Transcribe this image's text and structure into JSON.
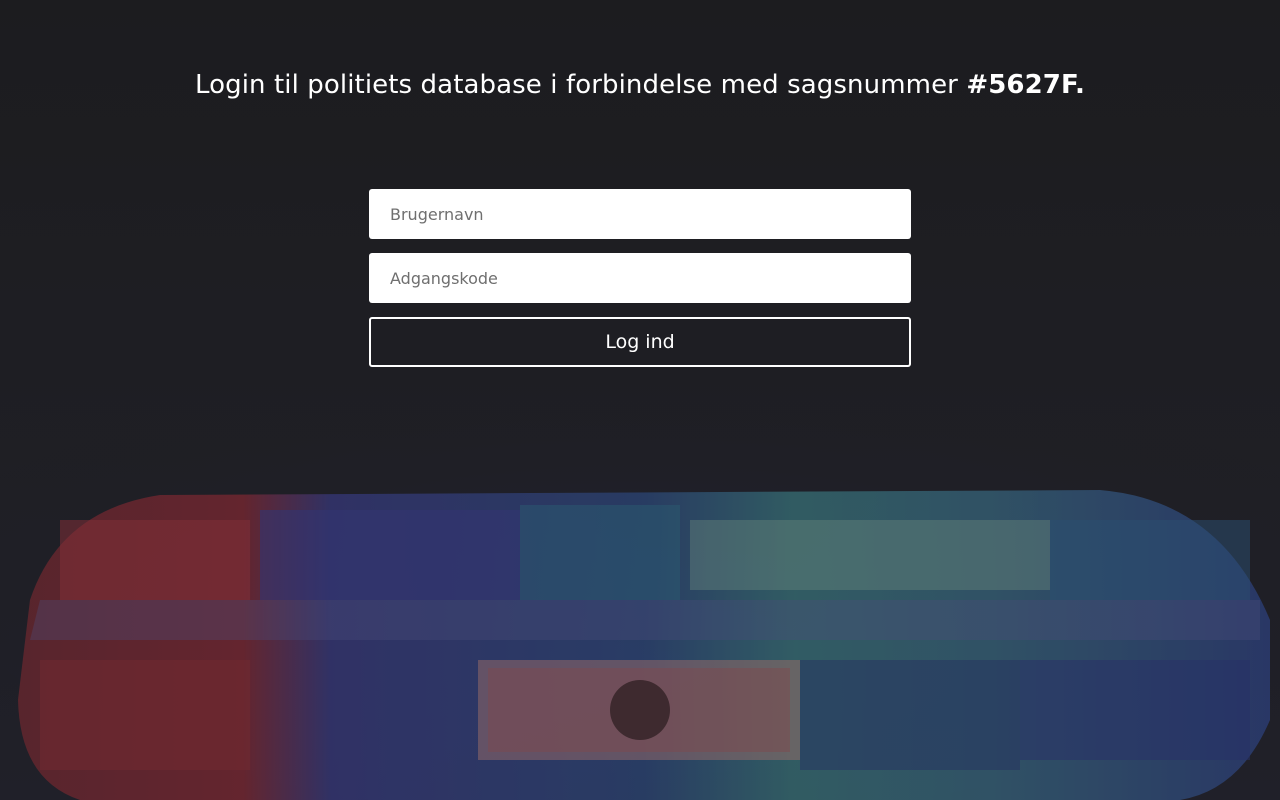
{
  "header": {
    "title_prefix": "Login til politiets database i forbindelse med sagsnummer",
    "case_number": "#5627F."
  },
  "login_form": {
    "username_placeholder": "Brugernavn",
    "password_placeholder": "Adgangskode",
    "submit_label": "Log ind"
  },
  "colors": {
    "background": "#1d1d1f",
    "text": "#ffffff",
    "light_red": "#b0323a",
    "light_blue": "#3a3f9a",
    "light_green": "#3aa89a"
  },
  "background_image": {
    "icon": "police-light-bar-image"
  }
}
